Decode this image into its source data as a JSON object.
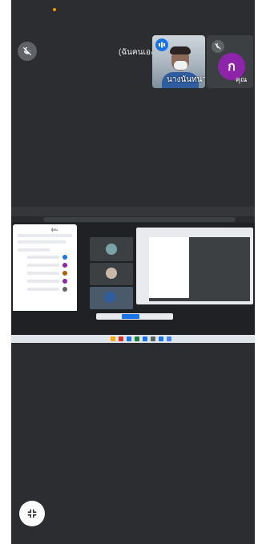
{
  "main_tile": {
    "name_label": "(ฉันคนเอง)"
  },
  "self_tile": {
    "name": "นางนันทนา",
    "state": "speaking"
  },
  "other_tile": {
    "avatar_initial": "ก",
    "name": "คุณ"
  },
  "shared_screen": {
    "panel_title": "ผู้คน",
    "tiles_count": 3
  },
  "controls": {
    "exit_fullscreen_icon": "exit-fullscreen-icon"
  },
  "colors": {
    "background": "#2c2d30",
    "accent": "#1a73e8",
    "avatar": "#8e24aa",
    "status_dot": "#f29900"
  }
}
